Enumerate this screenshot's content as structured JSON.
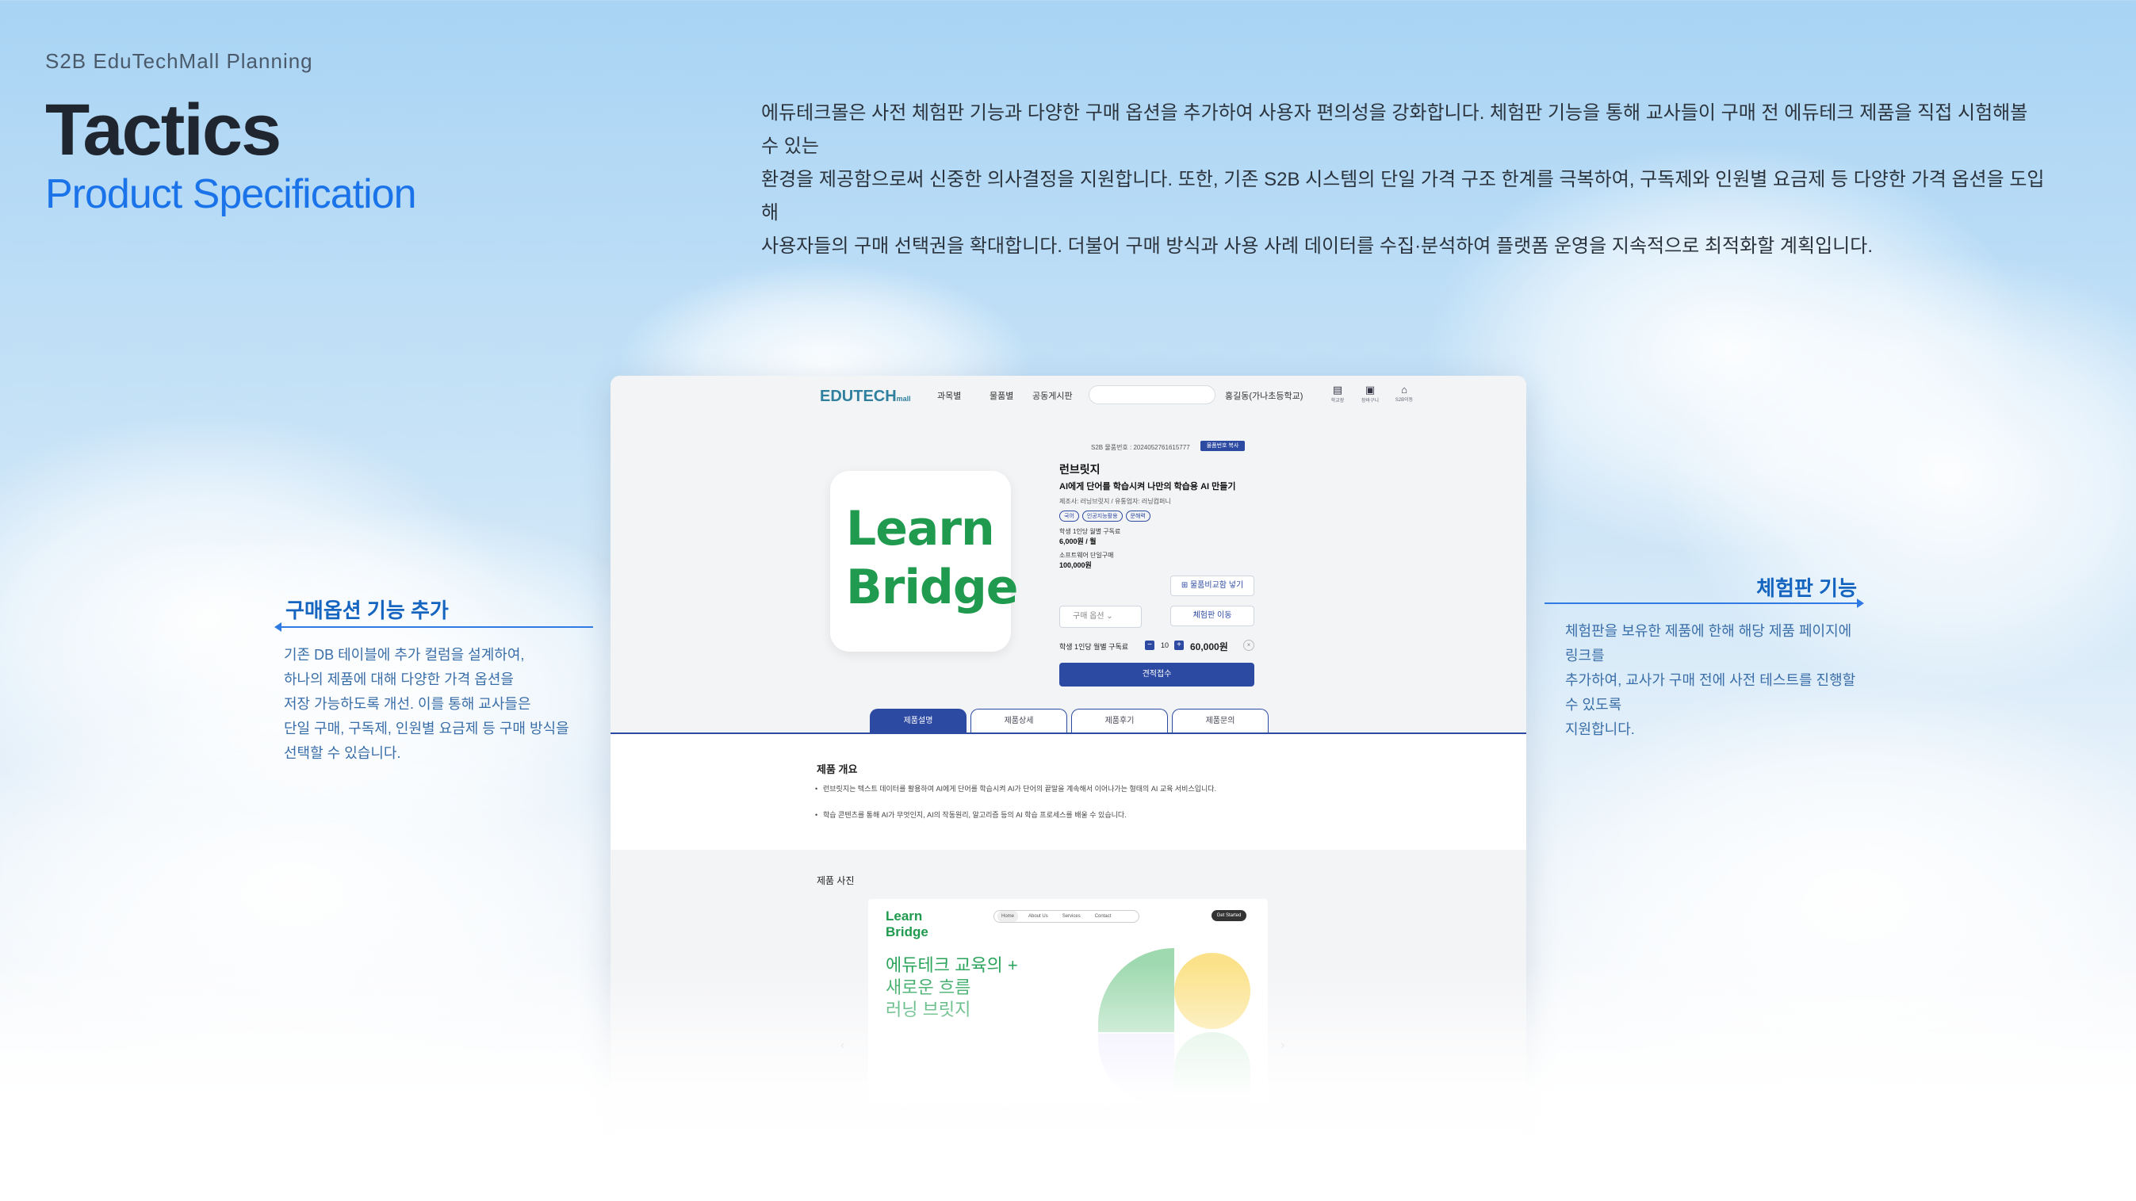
{
  "header": {
    "tag": "S2B EduTechMall Planning",
    "title": "Tactics",
    "subtitle": "Product Specification"
  },
  "intro": {
    "lines": [
      "에듀테크몰은 사전 체험판 기능과 다양한 구매 옵션을 추가하여 사용자 편의성을 강화합니다. 체험판 기능을 통해 교사들이 구매 전 에듀테크 제품을 직접 시험해볼 수 있는",
      "환경을 제공함으로써 신중한 의사결정을 지원합니다. 또한, 기존 S2B 시스템의 단일 가격 구조 한계를 극복하여, 구독제와 인원별 요금제 등 다양한 가격 옵션을 도입해",
      "사용자들의 구매 선택권을 확대합니다. 더불어 구매 방식과 사용 사례 데이터를 수집·분석하여 플랫폼 운영을 지속적으로 최적화할 계획입니다."
    ]
  },
  "callout_left": {
    "title": "구매옵션 기능 추가",
    "lines": [
      "기존 DB 테이블에 추가 컬럼을 설계하여,",
      "하나의 제품에 대해 다양한 가격 옵션을",
      "저장 가능하도록 개선. 이를 통해 교사들은",
      "단일 구매, 구독제, 인원별 요금제 등 구매 방식을",
      "선택할 수 있습니다."
    ]
  },
  "callout_right": {
    "title": "체험판 기능",
    "lines": [
      "체험판을 보유한 제품에 한해 해당 제품 페이지에 링크를",
      "추가하여, 교사가 구매 전에 사전 테스트를 진행할 수 있도록",
      "지원합니다."
    ]
  },
  "mockup": {
    "nav": {
      "logo": "EDUTECH",
      "logo_suffix": "mall",
      "links": [
        "과목별",
        "물품별",
        "공동게시판"
      ],
      "user": "홍길동(가나초등학교)",
      "icons": [
        {
          "icon": "store-icon",
          "label": "학교장"
        },
        {
          "icon": "clipboard-icon",
          "label": "장바구니"
        },
        {
          "icon": "home-icon",
          "label": "S2B이동"
        }
      ]
    },
    "product": {
      "image_text": [
        "Learn",
        "Bridge"
      ],
      "reg_no": "S2B 물품번호 : 2024052761615777",
      "reg_badge": "물품번호 복사",
      "name": "런브릿지",
      "desc": "AI에게 단어를 학습시켜 나만의 학습용 AI 만들기",
      "maker": "제조사: 러닝브릿지 / 유통업자: 러닝컴퍼니",
      "tags": [
        "국어",
        "인공지능활용",
        "문해력"
      ],
      "price1_label": "학생 1인당 월별 구독료",
      "price1_value": "6,000원 / 월",
      "price2_label": "소프트웨어 단일구매",
      "price2_value": "100,000원",
      "compare_button": "물품비교함 넣기",
      "trial_button": "체험판 이동",
      "option_select": "구매 옵션",
      "qty_label": "학생 1인당 월별 구독료",
      "qty_value": "10",
      "qty_price": "60,000원",
      "qty_remove": "×",
      "order_button": "견적접수"
    },
    "tabs": [
      "제품설명",
      "제품상세",
      "제품후기",
      "제품문의"
    ],
    "overview": {
      "title": "제품 개요",
      "bullets": [
        "런브릿지는 텍스트 데이터를 활용하여 AI에게 단어를 학습시켜 AI가 단어의 끝말을 계속해서 이어나가는 형태의 AI 교육 서비스입니다.",
        "학습 콘텐츠를 통해 AI가 무엇인지, AI의 작동원리, 알고리즘 등의 AI 학습 프로세스를 배울 수 있습니다."
      ]
    },
    "photo": {
      "title": "제품 사진",
      "site_logo": [
        "Learn",
        "Bridge"
      ],
      "site_nav": [
        "Home",
        "About Us",
        "Services",
        "Contact"
      ],
      "site_cta": "Get Started",
      "headline": [
        "에듀테크 교육의 +",
        "새로운 흐름",
        "러닝 브릿지"
      ]
    }
  }
}
